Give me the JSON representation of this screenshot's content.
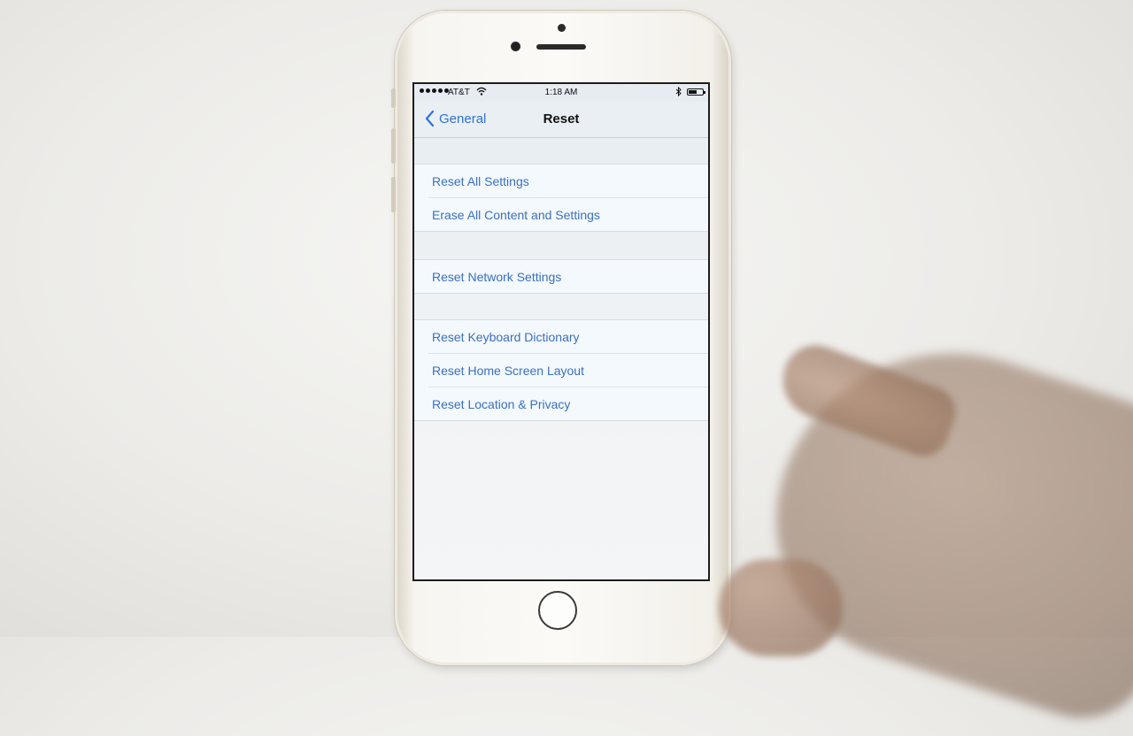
{
  "status_bar": {
    "carrier": "AT&T",
    "time": "1:18 AM",
    "signal_icon": "signal-dots-icon",
    "wifi_icon": "wifi-icon",
    "bluetooth_icon": "bluetooth-icon",
    "battery_icon": "battery-icon",
    "battery_level": 0.6
  },
  "nav_bar": {
    "back_label": "General",
    "back_icon": "chevron-left-icon",
    "title": "Reset"
  },
  "groups": [
    {
      "items": [
        "Reset All Settings",
        "Erase All Content and Settings"
      ]
    },
    {
      "items": [
        "Reset Network Settings"
      ]
    },
    {
      "items": [
        "Reset Keyboard Dictionary",
        "Reset Home Screen Layout",
        "Reset Location & Privacy"
      ]
    }
  ],
  "colors": {
    "accent": "#2f73d8",
    "row_text": "#3b6fc0",
    "screen_bg": "#eef2f5"
  }
}
